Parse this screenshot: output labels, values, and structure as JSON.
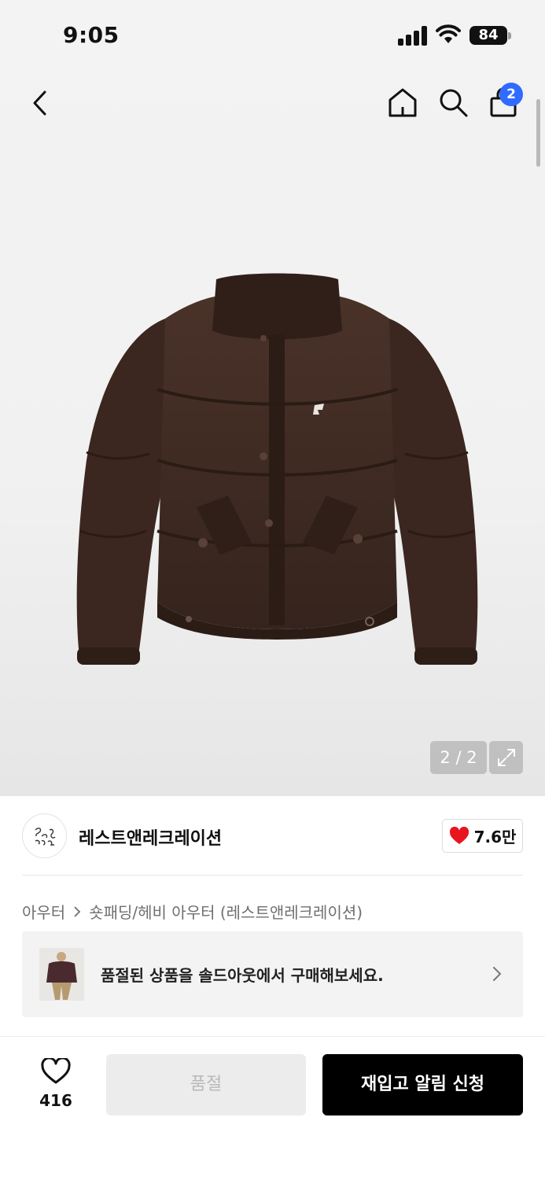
{
  "status_bar": {
    "time": "9:05",
    "battery": "84"
  },
  "header": {
    "cart_badge": "2"
  },
  "image": {
    "counter": "2 / 2"
  },
  "brand": {
    "name": "레스트앤레크레이션",
    "likes": "7.6만"
  },
  "breadcrumb": {
    "level1": "아우터",
    "level2": "숏패딩/헤비 아우터 (레스트앤레크레이션)"
  },
  "soldout_banner": {
    "text": "품절된 상품을 솔드아웃에서 구매해보세요."
  },
  "actions": {
    "wish_count": "416",
    "soldout_label": "품절",
    "restock_label": "재입고 알림 신청"
  },
  "colors": {
    "accent_blue": "#2f6bff",
    "heart_red": "#e8141e",
    "jacket_brown": "#3d2a22",
    "primary_button": "#000000"
  },
  "icons": [
    "back-icon",
    "home-icon",
    "search-icon",
    "shopping-bag-icon",
    "expand-icon",
    "heart-filled-icon",
    "chevron-right-icon",
    "heart-outline-icon"
  ]
}
